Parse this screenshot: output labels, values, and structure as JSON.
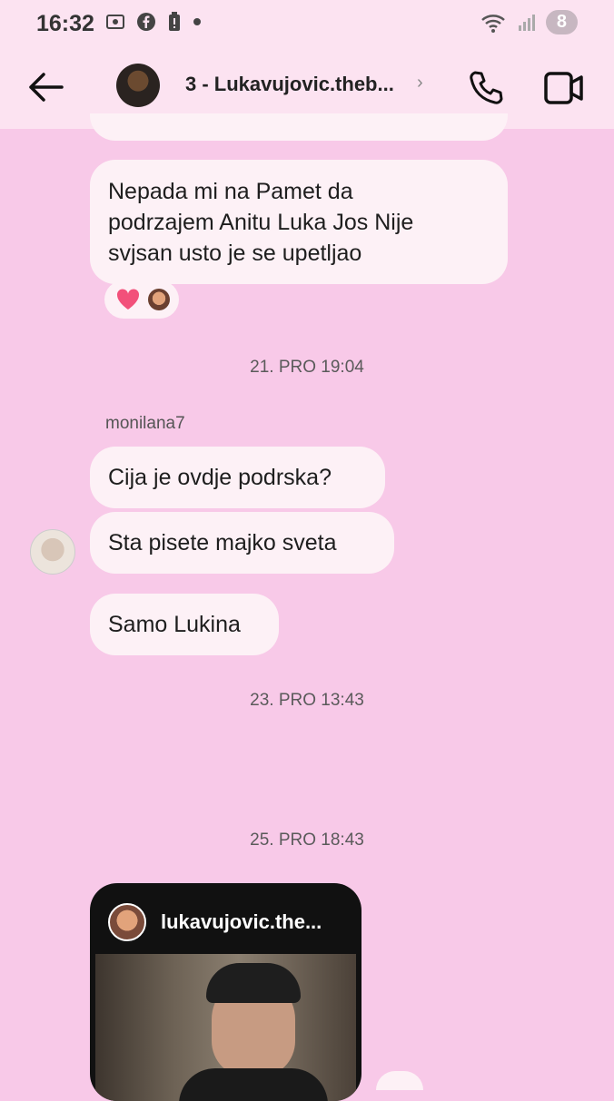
{
  "status_bar": {
    "time": "16:32",
    "battery": "8"
  },
  "header": {
    "title": "3 - Lukavujovic.theb...",
    "chevron": "›"
  },
  "messages": {
    "m1": {
      "lines": [
        "Nepada mi na Pamet da",
        "podrzajem Anitu  Luka  Jos Nije",
        "svjsan usto je se upetljao"
      ]
    },
    "ts1": "21. PRO 19:04",
    "sender": "monilana7",
    "m2": "Cija je ovdje podrska?",
    "m3": "Sta pisete majko sveta",
    "m4": "Samo Lukina",
    "ts2": "23. PRO 13:43",
    "ts3": "25. PRO 18:43"
  },
  "shared_post": {
    "username": "lukavujovic.the..."
  },
  "colors": {
    "background": "#f8c9e8",
    "bubble": "#fdf1f6",
    "header": "#fce3f1"
  }
}
